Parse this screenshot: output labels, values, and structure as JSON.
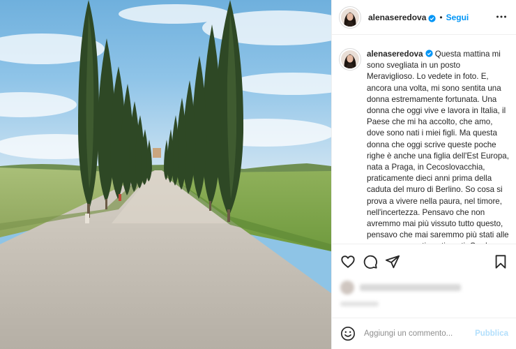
{
  "post": {
    "author": {
      "username": "alenaseredova",
      "verified": true,
      "avatar": "profile-avatar"
    },
    "follow_label": "Segui",
    "header_separator": "•",
    "caption": {
      "username": "alenaseredova",
      "text": "Questa mattina mi sono svegliata in un posto Meraviglioso. Lo vedete in foto. E, ancora una volta, mi sono sentita una donna estremamente fortunata. Una donna che oggi vive e lavora in Italia, il Paese che mi ha accolto, che amo, dove sono nati i miei figli. Ma questa donna che oggi scrive queste poche righe è anche una figlia dell'Est Europa, nata a Praga, in Cecoslovacchia, praticamente dieci anni prima della caduta del muro di Berlino. So cosa si prova a vivere nella paura, nel timore, nell'incertezza. Pensavo che non avremmo mai più vissuto tutto questo, pensavo che mai saremmo più stati alle prese con questi sentimenti. Credevo,"
    },
    "photo": {
      "subject": "cypress-lined gravel road",
      "colors": {
        "sky": "#7fbbe3",
        "grass": "#9fb86a",
        "road": "#bdb7ad",
        "cypress": "#2f4a25"
      }
    }
  },
  "actions": {
    "like": "heart-icon",
    "comment": "comment-icon",
    "share": "share-icon",
    "save": "bookmark-icon"
  },
  "comment_box": {
    "placeholder": "Aggiungi un commento...",
    "publish_label": "Pubblica",
    "emoji": "emoji-icon"
  },
  "colors": {
    "accent": "#0095f6",
    "publish_disabled": "#b2dffc",
    "text": "#262626",
    "muted": "#8e8e8e",
    "border": "#efefef"
  }
}
